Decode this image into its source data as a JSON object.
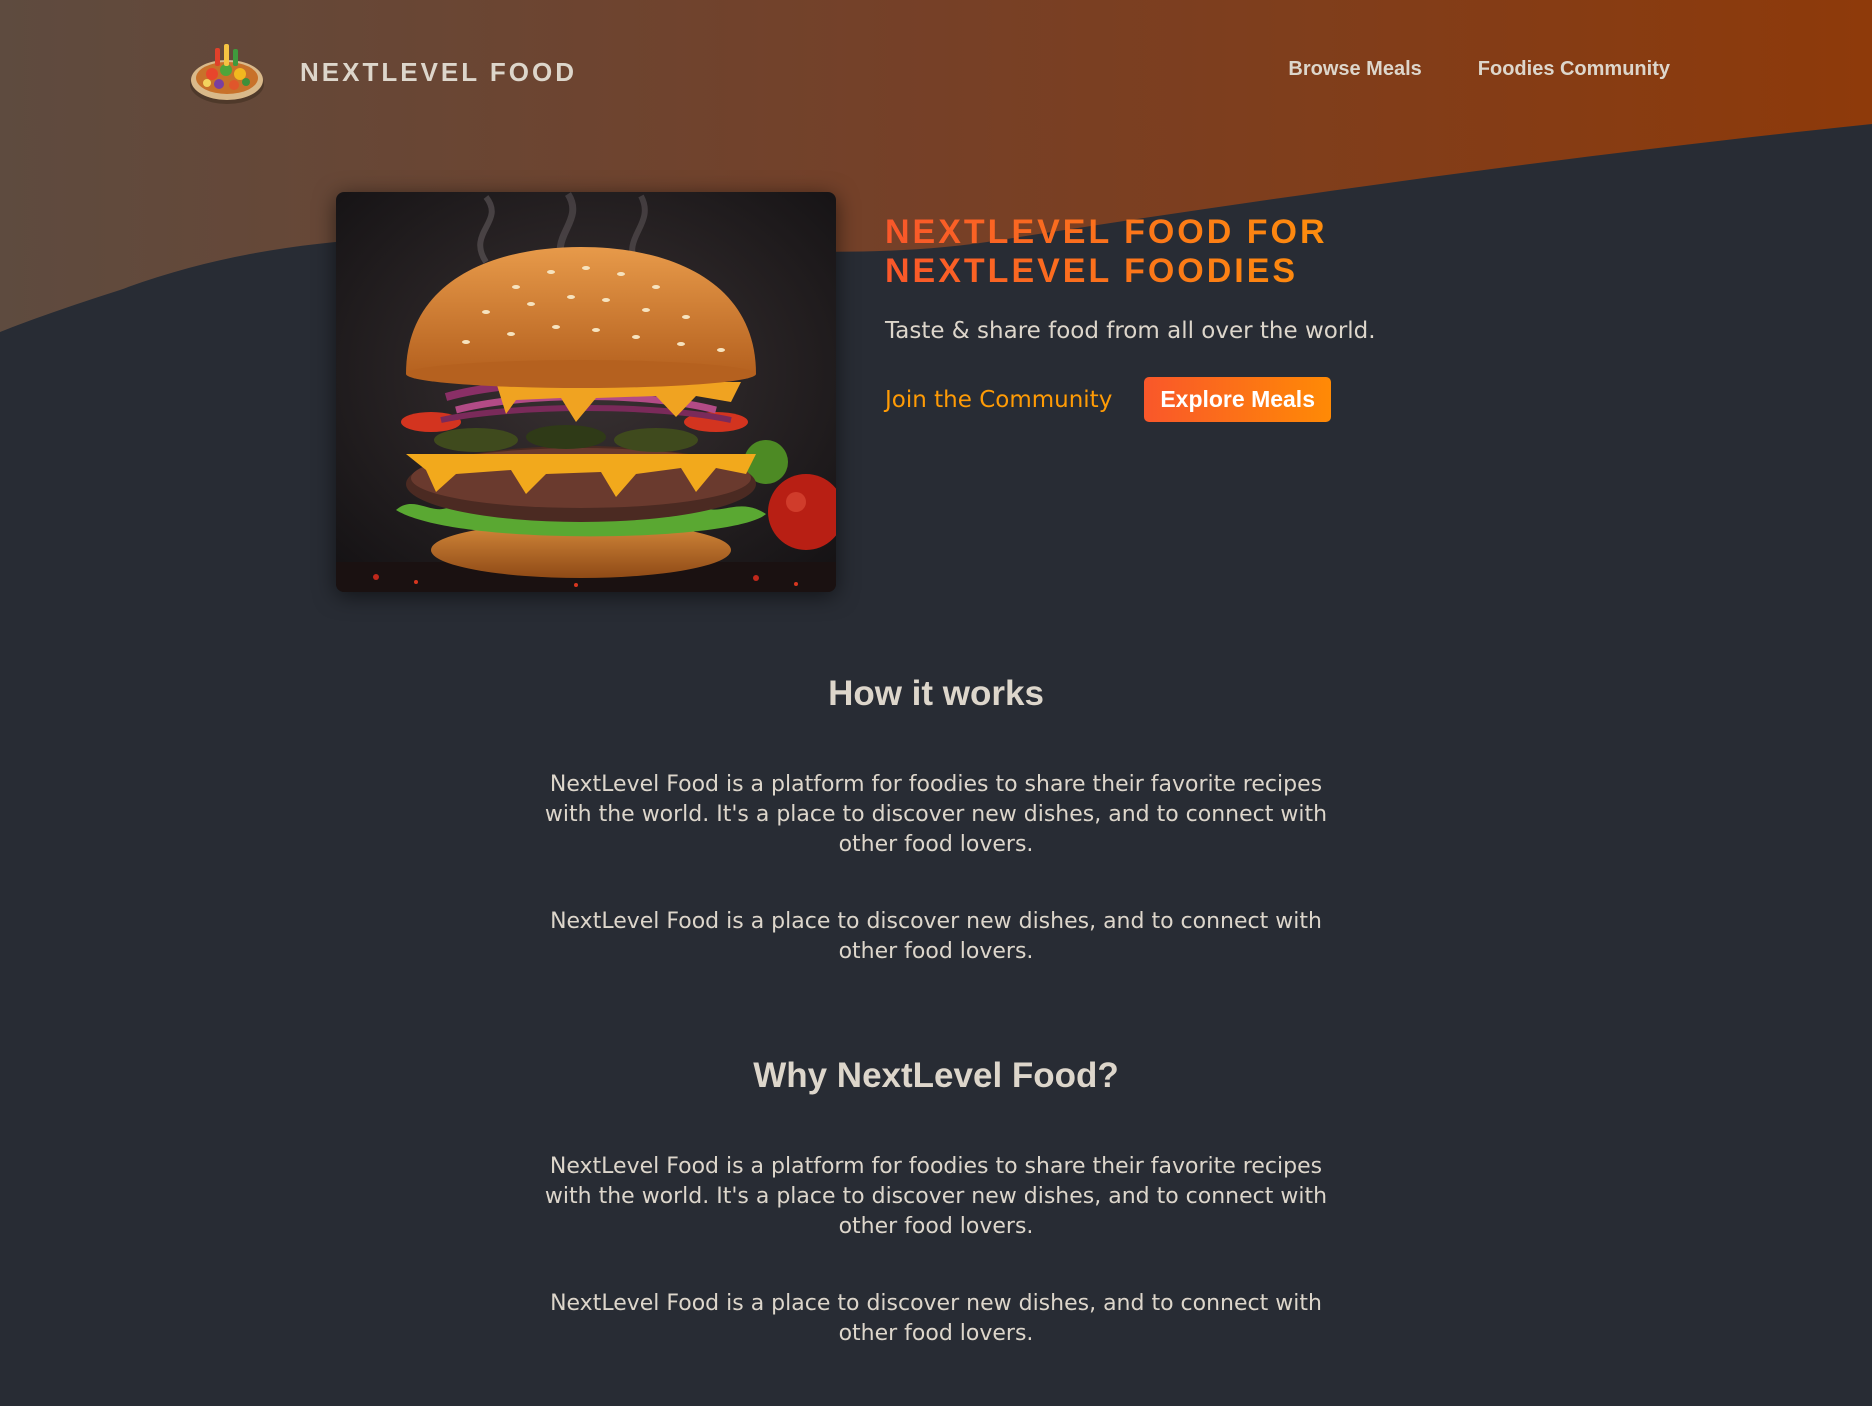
{
  "header": {
    "brand_name": "NextLevel Food",
    "logo_icon": "food-plate-logo-icon",
    "nav": [
      {
        "label": "Browse Meals"
      },
      {
        "label": "Foodies Community"
      }
    ]
  },
  "hero": {
    "image_icon": "burger-image",
    "title": "NextLevel Food for NextLevel Foodies",
    "subtitle": "Taste & share food from all over the world.",
    "cta_link": "Join the Community",
    "cta_button": "Explore Meals"
  },
  "sections": [
    {
      "title": "How it works",
      "paragraphs": [
        "NextLevel Food is a platform for foodies to share their favorite recipes with the world. It's a place to discover new dishes, and to connect with other food lovers.",
        "NextLevel Food is a place to discover new dishes, and to connect with other food lovers."
      ]
    },
    {
      "title": "Why NextLevel Food?",
      "paragraphs": [
        "NextLevel Food is a platform for foodies to share their favorite recipes with the world. It's a place to discover new dishes, and to connect with other food lovers.",
        "NextLevel Food is a place to discover new dishes, and to connect with other food lovers."
      ]
    }
  ],
  "colors": {
    "background": "#282c34",
    "accent_start": "#f9572a",
    "accent_end": "#ff9b05",
    "text": "#ddd6cb",
    "header_gradient_left": "#5c4a3f",
    "header_gradient_right": "#8c3a0a"
  }
}
